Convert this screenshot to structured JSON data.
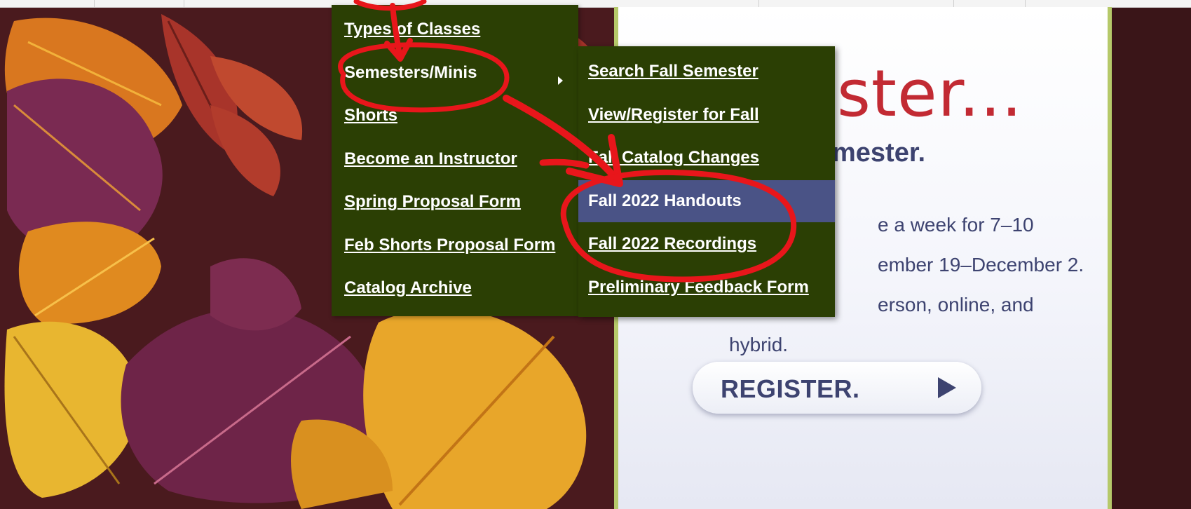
{
  "menu": {
    "items": [
      {
        "label": "Types of Classes"
      },
      {
        "label": "Semesters/Minis"
      },
      {
        "label": "Shorts"
      },
      {
        "label": "Become an Instructor"
      },
      {
        "label": "Spring Proposal Form"
      },
      {
        "label": "Feb Shorts Proposal Form"
      },
      {
        "label": "Catalog Archive"
      }
    ],
    "expanded_item": "Semesters/Minis"
  },
  "submenu": {
    "items": [
      {
        "label": "Search Fall Semester"
      },
      {
        "label": "View/Register for Fall"
      },
      {
        "label": "Fall Catalog Changes"
      },
      {
        "label": "Fall 2022 Handouts"
      },
      {
        "label": "Fall 2022 Recordings"
      },
      {
        "label": "Preliminary Feedback Form"
      }
    ],
    "highlighted_item": "Fall 2022 Handouts",
    "highlight_color": "#4a5386"
  },
  "promo": {
    "heading_partial": "ster...",
    "subheading_partial": "mester.",
    "body_line1": "e a week for 7–10",
    "body_line2": "ember 19–December 2.",
    "body_line3": "erson, online, and",
    "body_line4": "hybrid.",
    "register_label": "REGISTER."
  },
  "colors": {
    "menu_background": "#2b3f04",
    "heading_red": "#c22a33",
    "navy_text": "#3d4370",
    "annotation_red": "#e8161b",
    "panel_border_green": "#b6c96a"
  },
  "icons": {
    "submenu_indicator": "caret-right-icon",
    "register_button_icon": "play-icon"
  }
}
